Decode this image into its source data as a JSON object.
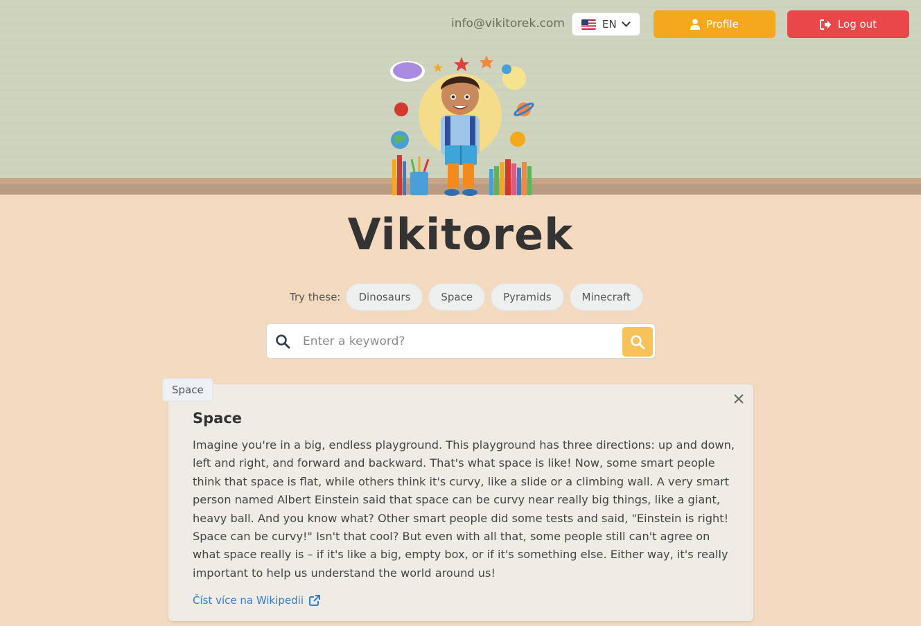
{
  "header": {
    "email": "info@vikitorek.com",
    "language": {
      "selected": "EN",
      "flag_icon": "us-flag-icon"
    },
    "profile_label": "Profile",
    "logout_label": "Log out"
  },
  "brand": {
    "title": "Vikitorek"
  },
  "suggestions": {
    "label": "Try these:",
    "items": [
      "Dinosaurs",
      "Space",
      "Pyramids",
      "Minecraft"
    ]
  },
  "search": {
    "placeholder": "Enter a keyword?",
    "value": ""
  },
  "result": {
    "tag": "Space",
    "title": "Space",
    "body": "Imagine you're in a big, endless playground. This playground has three directions: up and down, left and right, and forward and backward. That's what space is like! Now, some smart people think that space is flat, while others think it's curvy, like a slide or a climbing wall. A very smart person named Albert Einstein said that space can be curvy near really big things, like a giant, heavy ball. And you know what? Other smart people did some tests and said, \"Einstein is right! Space can be curvy!\" Isn't that cool? But even with all that, some people still can't agree on what space really is – if it's like a big, empty box, or if it's something else. Either way, it's really important to help us understand the world around us!",
    "link_label": "Číst více na Wikipedii"
  },
  "colors": {
    "accent": "#f5a81c",
    "danger": "#e9474a",
    "background": "#f3d9bd",
    "wall": "#cfd4bf",
    "link": "#2f7bd3"
  }
}
